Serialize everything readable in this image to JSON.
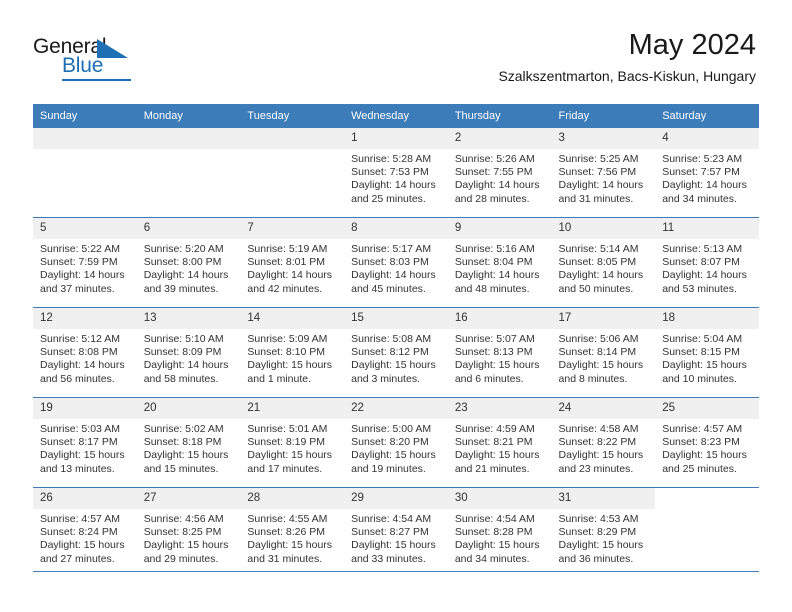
{
  "brand": {
    "name_part1": "General",
    "name_part2": "Blue",
    "accent_color": "#1f6fb5"
  },
  "header": {
    "title": "May 2024",
    "subtitle": "Szalkszentmarton, Bacs-Kiskun, Hungary"
  },
  "theme": {
    "header_bar_color": "#3b7cb9",
    "daynum_band_color": "#f0f0f0",
    "text_color": "#333333"
  },
  "weekday_headers": [
    "Sunday",
    "Monday",
    "Tuesday",
    "Wednesday",
    "Thursday",
    "Friday",
    "Saturday"
  ],
  "weeks": [
    [
      {
        "day": "",
        "blank": true,
        "sunrise": "",
        "sunset": "",
        "daylight1": "",
        "daylight2": ""
      },
      {
        "day": "",
        "blank": true,
        "sunrise": "",
        "sunset": "",
        "daylight1": "",
        "daylight2": ""
      },
      {
        "day": "",
        "blank": true,
        "sunrise": "",
        "sunset": "",
        "daylight1": "",
        "daylight2": ""
      },
      {
        "day": "1",
        "sunrise": "Sunrise: 5:28 AM",
        "sunset": "Sunset: 7:53 PM",
        "daylight1": "Daylight: 14 hours",
        "daylight2": "and 25 minutes."
      },
      {
        "day": "2",
        "sunrise": "Sunrise: 5:26 AM",
        "sunset": "Sunset: 7:55 PM",
        "daylight1": "Daylight: 14 hours",
        "daylight2": "and 28 minutes."
      },
      {
        "day": "3",
        "sunrise": "Sunrise: 5:25 AM",
        "sunset": "Sunset: 7:56 PM",
        "daylight1": "Daylight: 14 hours",
        "daylight2": "and 31 minutes."
      },
      {
        "day": "4",
        "sunrise": "Sunrise: 5:23 AM",
        "sunset": "Sunset: 7:57 PM",
        "daylight1": "Daylight: 14 hours",
        "daylight2": "and 34 minutes."
      }
    ],
    [
      {
        "day": "5",
        "sunrise": "Sunrise: 5:22 AM",
        "sunset": "Sunset: 7:59 PM",
        "daylight1": "Daylight: 14 hours",
        "daylight2": "and 37 minutes."
      },
      {
        "day": "6",
        "sunrise": "Sunrise: 5:20 AM",
        "sunset": "Sunset: 8:00 PM",
        "daylight1": "Daylight: 14 hours",
        "daylight2": "and 39 minutes."
      },
      {
        "day": "7",
        "sunrise": "Sunrise: 5:19 AM",
        "sunset": "Sunset: 8:01 PM",
        "daylight1": "Daylight: 14 hours",
        "daylight2": "and 42 minutes."
      },
      {
        "day": "8",
        "sunrise": "Sunrise: 5:17 AM",
        "sunset": "Sunset: 8:03 PM",
        "daylight1": "Daylight: 14 hours",
        "daylight2": "and 45 minutes."
      },
      {
        "day": "9",
        "sunrise": "Sunrise: 5:16 AM",
        "sunset": "Sunset: 8:04 PM",
        "daylight1": "Daylight: 14 hours",
        "daylight2": "and 48 minutes."
      },
      {
        "day": "10",
        "sunrise": "Sunrise: 5:14 AM",
        "sunset": "Sunset: 8:05 PM",
        "daylight1": "Daylight: 14 hours",
        "daylight2": "and 50 minutes."
      },
      {
        "day": "11",
        "sunrise": "Sunrise: 5:13 AM",
        "sunset": "Sunset: 8:07 PM",
        "daylight1": "Daylight: 14 hours",
        "daylight2": "and 53 minutes."
      }
    ],
    [
      {
        "day": "12",
        "sunrise": "Sunrise: 5:12 AM",
        "sunset": "Sunset: 8:08 PM",
        "daylight1": "Daylight: 14 hours",
        "daylight2": "and 56 minutes."
      },
      {
        "day": "13",
        "sunrise": "Sunrise: 5:10 AM",
        "sunset": "Sunset: 8:09 PM",
        "daylight1": "Daylight: 14 hours",
        "daylight2": "and 58 minutes."
      },
      {
        "day": "14",
        "sunrise": "Sunrise: 5:09 AM",
        "sunset": "Sunset: 8:10 PM",
        "daylight1": "Daylight: 15 hours",
        "daylight2": "and 1 minute."
      },
      {
        "day": "15",
        "sunrise": "Sunrise: 5:08 AM",
        "sunset": "Sunset: 8:12 PM",
        "daylight1": "Daylight: 15 hours",
        "daylight2": "and 3 minutes."
      },
      {
        "day": "16",
        "sunrise": "Sunrise: 5:07 AM",
        "sunset": "Sunset: 8:13 PM",
        "daylight1": "Daylight: 15 hours",
        "daylight2": "and 6 minutes."
      },
      {
        "day": "17",
        "sunrise": "Sunrise: 5:06 AM",
        "sunset": "Sunset: 8:14 PM",
        "daylight1": "Daylight: 15 hours",
        "daylight2": "and 8 minutes."
      },
      {
        "day": "18",
        "sunrise": "Sunrise: 5:04 AM",
        "sunset": "Sunset: 8:15 PM",
        "daylight1": "Daylight: 15 hours",
        "daylight2": "and 10 minutes."
      }
    ],
    [
      {
        "day": "19",
        "sunrise": "Sunrise: 5:03 AM",
        "sunset": "Sunset: 8:17 PM",
        "daylight1": "Daylight: 15 hours",
        "daylight2": "and 13 minutes."
      },
      {
        "day": "20",
        "sunrise": "Sunrise: 5:02 AM",
        "sunset": "Sunset: 8:18 PM",
        "daylight1": "Daylight: 15 hours",
        "daylight2": "and 15 minutes."
      },
      {
        "day": "21",
        "sunrise": "Sunrise: 5:01 AM",
        "sunset": "Sunset: 8:19 PM",
        "daylight1": "Daylight: 15 hours",
        "daylight2": "and 17 minutes."
      },
      {
        "day": "22",
        "sunrise": "Sunrise: 5:00 AM",
        "sunset": "Sunset: 8:20 PM",
        "daylight1": "Daylight: 15 hours",
        "daylight2": "and 19 minutes."
      },
      {
        "day": "23",
        "sunrise": "Sunrise: 4:59 AM",
        "sunset": "Sunset: 8:21 PM",
        "daylight1": "Daylight: 15 hours",
        "daylight2": "and 21 minutes."
      },
      {
        "day": "24",
        "sunrise": "Sunrise: 4:58 AM",
        "sunset": "Sunset: 8:22 PM",
        "daylight1": "Daylight: 15 hours",
        "daylight2": "and 23 minutes."
      },
      {
        "day": "25",
        "sunrise": "Sunrise: 4:57 AM",
        "sunset": "Sunset: 8:23 PM",
        "daylight1": "Daylight: 15 hours",
        "daylight2": "and 25 minutes."
      }
    ],
    [
      {
        "day": "26",
        "sunrise": "Sunrise: 4:57 AM",
        "sunset": "Sunset: 8:24 PM",
        "daylight1": "Daylight: 15 hours",
        "daylight2": "and 27 minutes."
      },
      {
        "day": "27",
        "sunrise": "Sunrise: 4:56 AM",
        "sunset": "Sunset: 8:25 PM",
        "daylight1": "Daylight: 15 hours",
        "daylight2": "and 29 minutes."
      },
      {
        "day": "28",
        "sunrise": "Sunrise: 4:55 AM",
        "sunset": "Sunset: 8:26 PM",
        "daylight1": "Daylight: 15 hours",
        "daylight2": "and 31 minutes."
      },
      {
        "day": "29",
        "sunrise": "Sunrise: 4:54 AM",
        "sunset": "Sunset: 8:27 PM",
        "daylight1": "Daylight: 15 hours",
        "daylight2": "and 33 minutes."
      },
      {
        "day": "30",
        "sunrise": "Sunrise: 4:54 AM",
        "sunset": "Sunset: 8:28 PM",
        "daylight1": "Daylight: 15 hours",
        "daylight2": "and 34 minutes."
      },
      {
        "day": "31",
        "sunrise": "Sunrise: 4:53 AM",
        "sunset": "Sunset: 8:29 PM",
        "daylight1": "Daylight: 15 hours",
        "daylight2": "and 36 minutes."
      },
      {
        "day": "",
        "empty_tail": true,
        "sunrise": "",
        "sunset": "",
        "daylight1": "",
        "daylight2": ""
      }
    ]
  ]
}
